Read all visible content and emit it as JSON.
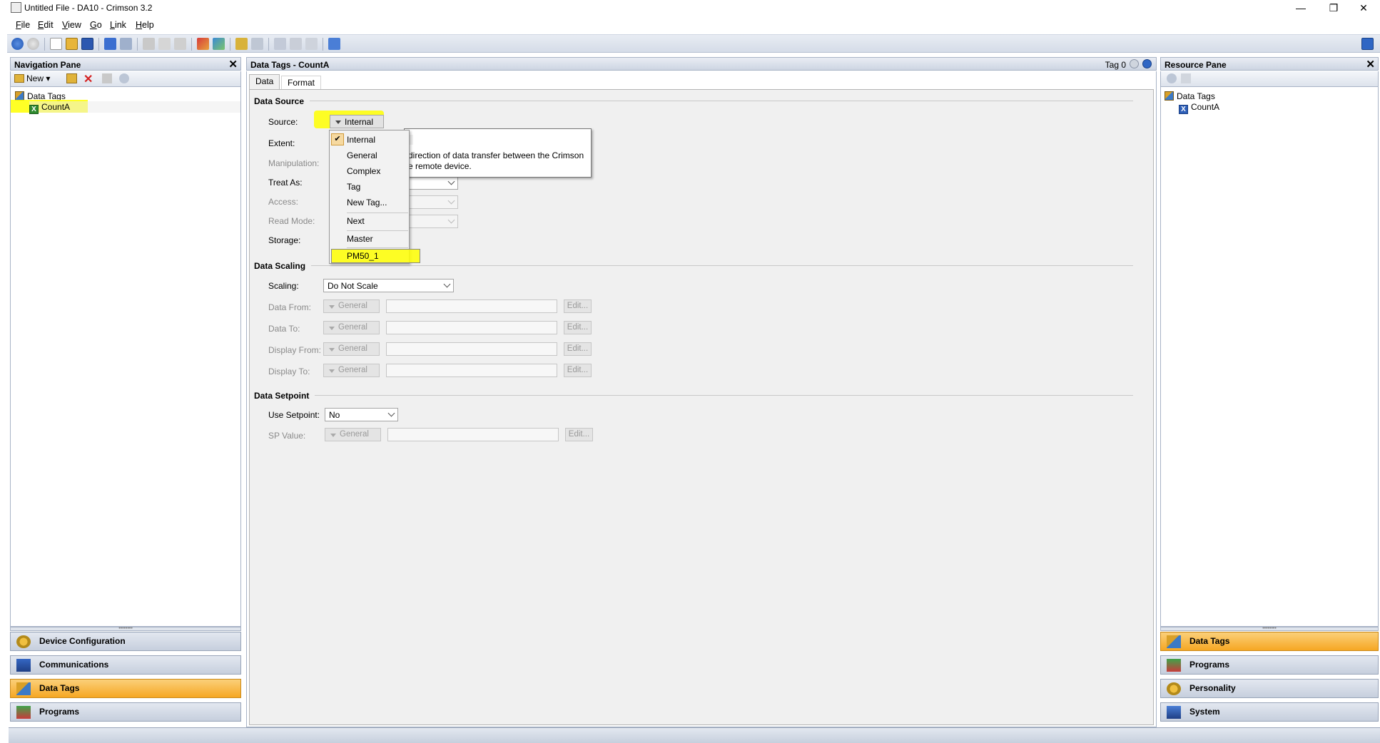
{
  "window": {
    "title": "Untitled File - DA10 - Crimson 3.2",
    "minimize": "—",
    "restore": "❐",
    "close": "✕"
  },
  "menu": [
    "File",
    "Edit",
    "View",
    "Go",
    "Link",
    "Help"
  ],
  "menu_underlines": [
    "F",
    "E",
    "V",
    "G",
    "L",
    "H"
  ],
  "navigation_pane": {
    "title": "Navigation Pane",
    "new_label": "New",
    "tree_root": "Data Tags",
    "tree_child": "CountA",
    "categories": [
      "Device Configuration",
      "Communications",
      "Data Tags",
      "Programs"
    ],
    "active_category": "Data Tags"
  },
  "center": {
    "header": "Data Tags - CountA",
    "tag_index": "Tag 0",
    "tabs": [
      "Data",
      "Format"
    ],
    "data_source": {
      "section": "Data Source",
      "source_label": "Source:",
      "source_value": "Internal",
      "extent_label": "Extent:",
      "manipulation_label": "Manipulation:",
      "treat_as_label": "Treat As:",
      "access_label": "Access:",
      "read_mode_label": "Read Mode:",
      "storage_label": "Storage:"
    },
    "data_scaling": {
      "section": "Data Scaling",
      "scaling_label": "Scaling:",
      "scaling_value": "Do Not Scale",
      "rows": [
        {
          "label": "Data From:",
          "button": "General",
          "edit": "Edit..."
        },
        {
          "label": "Data To:",
          "button": "General",
          "edit": "Edit..."
        },
        {
          "label": "Display From:",
          "button": "General",
          "edit": "Edit..."
        },
        {
          "label": "Display To:",
          "button": "General",
          "edit": "Edit..."
        }
      ]
    },
    "data_setpoint": {
      "section": "Data Setpoint",
      "use_setpoint_label": "Use Setpoint:",
      "use_setpoint_value": "No",
      "sp_value_label": "SP Value:",
      "sp_button": "General",
      "sp_edit": "Edit..."
    }
  },
  "source_dropdown": {
    "items": [
      "Internal",
      "General",
      "Complex",
      "Tag",
      "New Tag...",
      "Next",
      "Master",
      "PM50_1"
    ],
    "checked": "Internal",
    "highlighted": "PM50_1"
  },
  "tooltip": {
    "line1": "direction of data transfer between the Crimson",
    "line2": "e remote device."
  },
  "resource_pane": {
    "title": "Resource Pane",
    "tree_root": "Data Tags",
    "tree_child": "CountA",
    "categories": [
      "Data Tags",
      "Programs",
      "Personality",
      "System"
    ],
    "active_category": "Data Tags"
  },
  "colors": {
    "active_category": "#f6a723",
    "highlight": "#ffff00",
    "header_gradient": "#cdd5e2"
  }
}
